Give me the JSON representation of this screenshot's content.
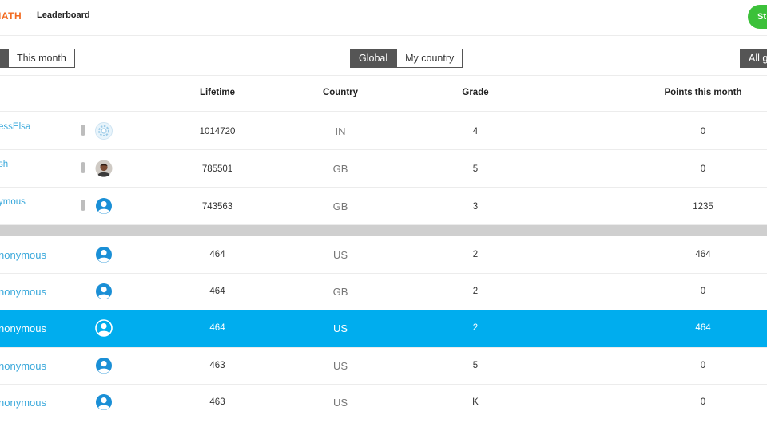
{
  "header": {
    "brand": "IATH",
    "breadcrumb": "Leaderboard",
    "cta_label": "St"
  },
  "filters": {
    "period": [
      "",
      "This month"
    ],
    "scope": [
      "Global",
      "My country"
    ],
    "grade": [
      "All g"
    ]
  },
  "columns": {
    "lifetime": "Lifetime",
    "country": "Country",
    "grade": "Grade",
    "points": "Points this month"
  },
  "rows": [
    {
      "name": "essElsa",
      "lifetime": "1014720",
      "country": "IN",
      "grade": "4",
      "points": "0",
      "avatar": "gear-avatar-icon"
    },
    {
      "name": "sh",
      "lifetime": "785501",
      "country": "GB",
      "grade": "5",
      "points": "0",
      "avatar": "photo-avatar-icon"
    },
    {
      "name": "ymous",
      "lifetime": "743563",
      "country": "GB",
      "grade": "3",
      "points": "1235",
      "avatar": "user-avatar-icon"
    },
    {
      "name": "nonymous",
      "lifetime": "464",
      "country": "US",
      "grade": "2",
      "points": "464",
      "avatar": "user-avatar-icon"
    },
    {
      "name": "nonymous",
      "lifetime": "464",
      "country": "GB",
      "grade": "2",
      "points": "0",
      "avatar": "user-avatar-icon"
    },
    {
      "name": "nonymous",
      "lifetime": "464",
      "country": "US",
      "grade": "2",
      "points": "464",
      "avatar": "user-avatar-icon",
      "selected": true
    },
    {
      "name": "nonymous",
      "lifetime": "463",
      "country": "US",
      "grade": "5",
      "points": "0",
      "avatar": "user-avatar-icon"
    },
    {
      "name": "nonymous",
      "lifetime": "463",
      "country": "US",
      "grade": "K",
      "points": "0",
      "avatar": "user-avatar-icon"
    }
  ],
  "colors": {
    "brand": "#f26b21",
    "accent": "#00adee",
    "link": "#39a8db",
    "cta": "#3cc13a",
    "avatar": "#1a8fd6"
  }
}
